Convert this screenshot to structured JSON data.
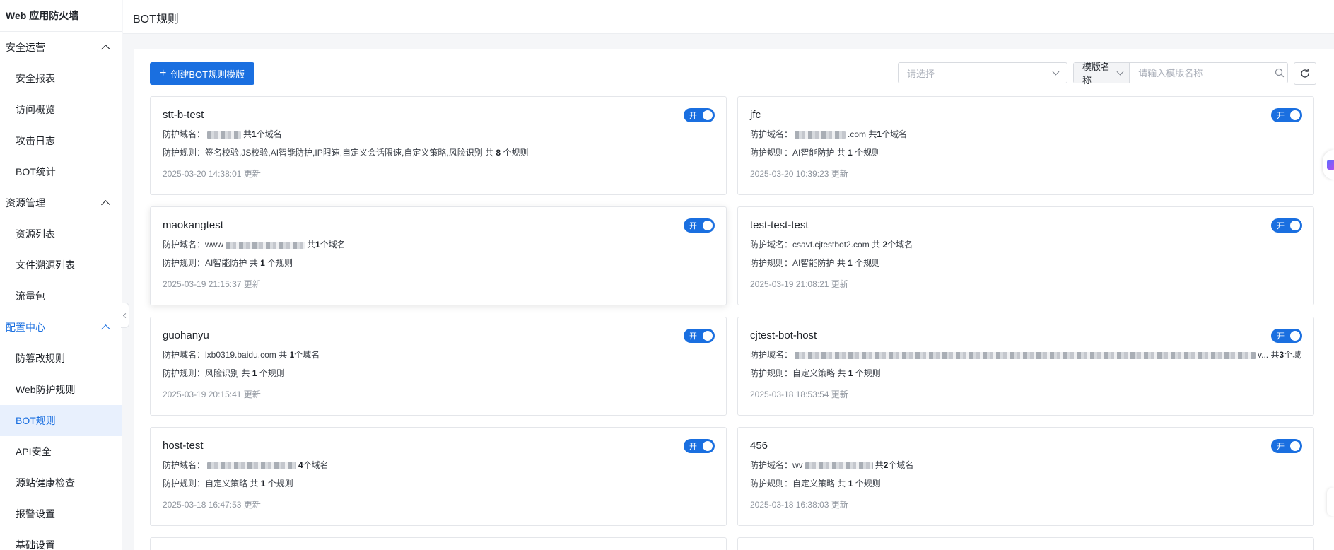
{
  "sidebar": {
    "brand": "Web 应用防火墙",
    "groups": [
      {
        "label": "安全运营",
        "items": [
          "安全报表",
          "访问概览",
          "攻击日志",
          "BOT统计"
        ]
      },
      {
        "label": "资源管理",
        "items": [
          "资源列表",
          "文件溯源列表",
          "流量包"
        ]
      },
      {
        "label": "配置中心",
        "items": [
          "防篡改规则",
          "Web防护规则",
          "BOT规则",
          "API安全",
          "源站健康检查",
          "报警设置",
          "基础设置"
        ]
      }
    ],
    "active_item": "BOT规则"
  },
  "header": {
    "title": "BOT规则"
  },
  "toolbar": {
    "create_label": "创建BOT规则模版",
    "select_placeholder": "请选择",
    "search_field": "模版名称",
    "search_placeholder": "请输入模版名称"
  },
  "labels": {
    "domain": "防护域名：",
    "rule": "防护规则：",
    "toggle_on": "开",
    "updated_suffix": "更新"
  },
  "cards": [
    {
      "name": "stt-b-test",
      "domain_text": "",
      "domain_count_prefix": "共",
      "domain_count": "1",
      "domain_count_suffix": "个域名",
      "rules": "签名校验,JS校验,AI智能防护,IP限速,自定义会话限速,自定义策略,风险识别",
      "rule_count_prefix": "共",
      "rule_count": "8",
      "rule_count_suffix": "个规则",
      "updated": "2025-03-20 14:38:01 更新"
    },
    {
      "name": "jfc",
      "domain_text": ".com",
      "domain_count_prefix": "共",
      "domain_count": "1",
      "domain_count_suffix": "个域名",
      "rules": "AI智能防护",
      "rule_count_prefix": "共",
      "rule_count": "1",
      "rule_count_suffix": "个规则",
      "updated": "2025-03-20 10:39:23 更新"
    },
    {
      "name": "maokangtest",
      "domain_text": "www",
      "domain_count_prefix": "共",
      "domain_count": "1",
      "domain_count_suffix": "个域名",
      "rules": "AI智能防护",
      "rule_count_prefix": "共",
      "rule_count": "1",
      "rule_count_suffix": "个规则",
      "updated": "2025-03-19 21:15:37 更新"
    },
    {
      "name": "test-test-test",
      "domain_text": "csavf.cjtestbot2.com",
      "domain_count_prefix": "共",
      "domain_count": "2",
      "domain_count_suffix": "个域名",
      "rules": "AI智能防护",
      "rule_count_prefix": "共",
      "rule_count": "1",
      "rule_count_suffix": "个规则",
      "updated": "2025-03-19 21:08:21 更新"
    },
    {
      "name": "guohanyu",
      "domain_text": "lxb0319.baidu.com",
      "domain_count_prefix": "共",
      "domain_count": "1",
      "domain_count_suffix": "个域名",
      "rules": "风险识别",
      "rule_count_prefix": "共",
      "rule_count": "1",
      "rule_count_suffix": "个规则",
      "updated": "2025-03-19 20:15:41 更新"
    },
    {
      "name": "cjtest-bot-host",
      "domain_text": "v...",
      "domain_count_prefix": "共",
      "domain_count": "3",
      "domain_count_suffix": "个域名",
      "rules": "自定义策略",
      "rule_count_prefix": "共",
      "rule_count": "1",
      "rule_count_suffix": "个规则",
      "updated": "2025-03-18 18:53:54 更新"
    },
    {
      "name": "host-test",
      "domain_text": "",
      "domain_count_prefix": "",
      "domain_count": "4",
      "domain_count_suffix": "个域名",
      "rules": "自定义策略",
      "rule_count_prefix": "共",
      "rule_count": "1",
      "rule_count_suffix": "个规则",
      "updated": "2025-03-18 16:47:53 更新"
    },
    {
      "name": "456",
      "domain_text": "wv",
      "domain_count_prefix": "共",
      "domain_count": "2",
      "domain_count_suffix": "个域名",
      "rules": "自定义策略",
      "rule_count_prefix": "共",
      "rule_count": "1",
      "rule_count_suffix": "个规则",
      "updated": "2025-03-18 16:38:03 更新"
    }
  ],
  "colors": {
    "accent": "#1a6fe0",
    "active_bg": "#e8f0fd"
  },
  "icons": {
    "create": "plus-icon",
    "search": "search-icon",
    "refresh": "refresh-icon",
    "collapse": "chevron-left-icon"
  }
}
